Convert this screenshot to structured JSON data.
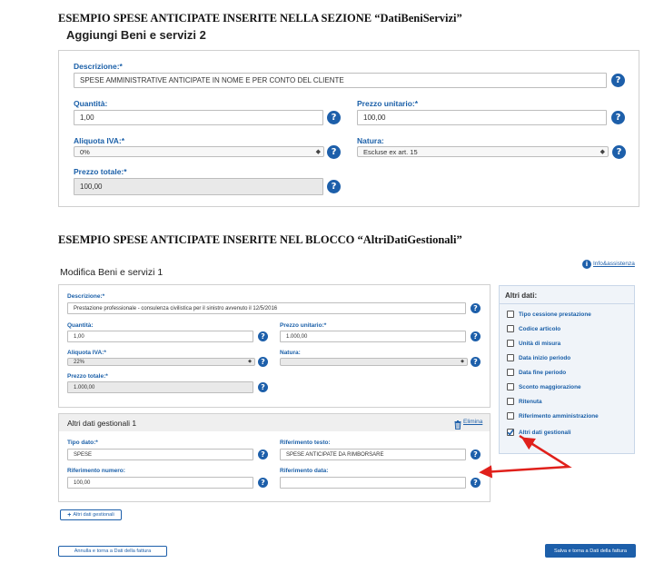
{
  "heading1": "ESEMPIO SPESE ANTICIPATE INSERITE NELLA SEZIONE “DatiBeniServizi”",
  "heading2": "ESEMPIO SPESE ANTICIPATE INSERITE NEL BLOCCO “AltriDatiGestionali”",
  "form1": {
    "title": "Aggiungi Beni e servizi 2",
    "descrizione_label": "Descrizione:*",
    "descrizione_value": "SPESE AMMINISTRATIVE ANTICIPATE IN NOME E PER CONTO DEL CLIENTE",
    "quantita_label": "Quantità:",
    "quantita_value": "1,00",
    "prezzo_unitario_label": "Prezzo unitario:*",
    "prezzo_unitario_value": "100,00",
    "aliquota_label": "Aliquota IVA:*",
    "aliquota_value": "0%",
    "natura_label": "Natura:",
    "natura_value": "Escluse ex art. 15",
    "prezzo_totale_label": "Prezzo totale:*",
    "prezzo_totale_value": "100,00"
  },
  "form2": {
    "title": "Modifica Beni e servizi 1",
    "info_link": "Info&assistenza",
    "descrizione_label": "Descrizione:*",
    "descrizione_value": "Prestazione professionale - consulenza civilistica per il sinistro avvenuto il 12/5/2016",
    "quantita_label": "Quantità:",
    "quantita_value": "1,00",
    "prezzo_unitario_label": "Prezzo unitario:*",
    "prezzo_unitario_value": "1.000,00",
    "aliquota_label": "Aliquota IVA:*",
    "aliquota_value": "22%",
    "natura_label": "Natura:",
    "natura_value": "",
    "prezzo_totale_label": "Prezzo totale:*",
    "prezzo_totale_value": "1.000,00"
  },
  "gestionali": {
    "title": "Altri dati gestionali 1",
    "elimina": "Elimina",
    "tipo_dato_label": "Tipo dato:*",
    "tipo_dato_value": "SPESE",
    "rif_testo_label": "Riferimento testo:",
    "rif_testo_value": "SPESE ANTICIPATE DA RIMBORSARE",
    "rif_numero_label": "Riferimento numero:",
    "rif_numero_value": "100,00",
    "rif_data_label": "Riferimento data:",
    "rif_data_value": "",
    "add_button": "Altri dati gestionali"
  },
  "altri_dati": {
    "title": "Altri dati:",
    "items": [
      {
        "label": "Tipo cessione prestazione",
        "checked": false
      },
      {
        "label": "Codice articolo",
        "checked": false
      },
      {
        "label": "Unità di misura",
        "checked": false
      },
      {
        "label": "Data inizio periodo",
        "checked": false
      },
      {
        "label": "Data fine periodo",
        "checked": false
      },
      {
        "label": "Sconto maggiorazione",
        "checked": false
      },
      {
        "label": "Ritenuta",
        "checked": false
      },
      {
        "label": "Riferimento amministrazione",
        "checked": false
      },
      {
        "label": "Altri dati gestionali",
        "checked": true
      }
    ]
  },
  "footer": {
    "cancel_button": "Annulla e torna a Dati della fattura",
    "save_button": "Salva e torna a Dati della fattura"
  },
  "colors": {
    "accent": "#1d5faa",
    "label": "#1a5fa8",
    "arrow": "#e0201b"
  }
}
